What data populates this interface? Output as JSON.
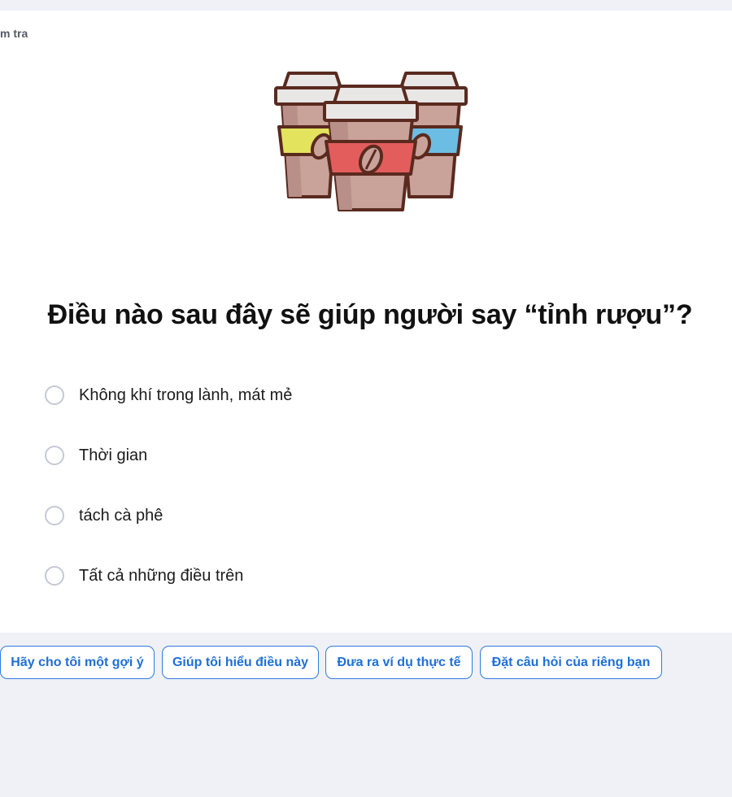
{
  "breadcrumb": "m tra",
  "illustration": {
    "icon": "coffee-cups-icon",
    "colors": {
      "outline": "#5a2a1f",
      "cup": "#c9a29a",
      "lid": "#e9e6e6",
      "yellow_sleeve": "#e4e35e",
      "red_sleeve": "#e35d5d",
      "blue_sleeve": "#6cbde4"
    }
  },
  "question": {
    "text": "Điều nào sau đây sẽ giúp người say “tỉnh rượu”?"
  },
  "options": [
    {
      "label": "Không khí trong lành, mát mẻ",
      "selected": false
    },
    {
      "label": "Thời gian",
      "selected": false
    },
    {
      "label": "tách cà phê",
      "selected": false
    },
    {
      "label": "Tất cả những điều trên",
      "selected": false
    }
  ],
  "actions": [
    {
      "label": "Hãy cho tôi một gợi ý"
    },
    {
      "label": "Giúp tôi hiểu điều này"
    },
    {
      "label": "Đưa ra ví dụ thực tế"
    },
    {
      "label": "Đặt câu hỏi của riêng bạn"
    }
  ],
  "theme": {
    "accent": "#2c7be0",
    "background": "#f0f1f6",
    "card": "#ffffff"
  }
}
